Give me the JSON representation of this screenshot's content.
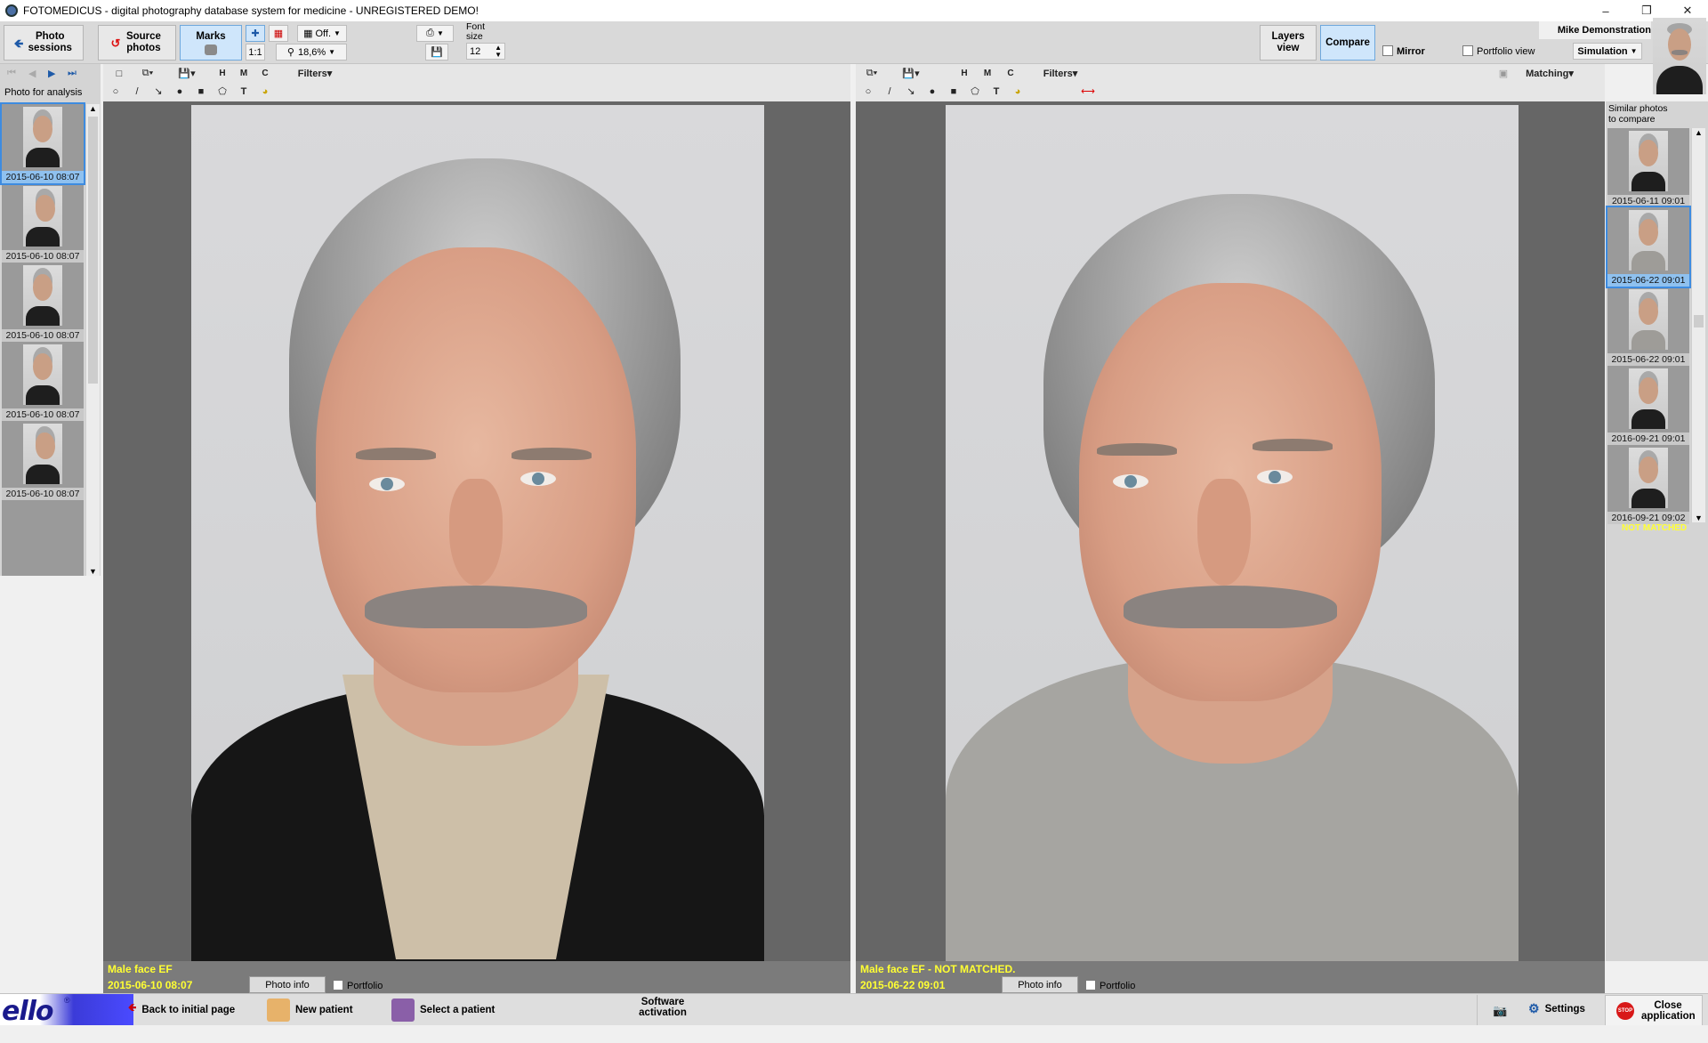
{
  "window": {
    "title": "FOTOMEDICUS - digital photography database system for medicine - UNREGISTERED DEMO!",
    "minimize": "–",
    "restore": "❐",
    "close": "✕"
  },
  "toolbar": {
    "photo_sessions": "Photo sessions",
    "source_photos": "Source photos",
    "marks": "Marks",
    "one_to_one": "1:1",
    "grid": "Off.",
    "zoom": "18,6%",
    "font_size_label": "Font size",
    "font_size_value": "12",
    "layers_view": "Layers view",
    "compare": "Compare",
    "mirror": "Mirror",
    "portfolio_view": "Portfolio view",
    "simulation": "Simulation",
    "user_name": "Mike Demonstration",
    "matching": "Matching"
  },
  "left": {
    "label": "Photo for analysis",
    "thumbnails": [
      {
        "date": "2015-06-10 08:07",
        "selected": true,
        "style": "dark"
      },
      {
        "date": "2015-06-10 08:07",
        "selected": false,
        "style": "profile"
      },
      {
        "date": "2015-06-10 08:07",
        "selected": false,
        "style": "dark"
      },
      {
        "date": "2015-06-10 08:07",
        "selected": false,
        "style": "dark"
      },
      {
        "date": "2015-06-10 08:07",
        "selected": false,
        "style": "profile"
      }
    ]
  },
  "editor_left": {
    "h": "H",
    "m": "M",
    "c": "C",
    "filters": "Filters",
    "text_tool": "T"
  },
  "editor_right": {
    "h": "H",
    "m": "M",
    "c": "C",
    "filters": "Filters",
    "text_tool": "T"
  },
  "photo_left": {
    "caption": "Male face EF",
    "date": "2015-06-10 08:07",
    "photo_info": "Photo info",
    "portfolio": "Portfolio"
  },
  "photo_right": {
    "caption": "Male face EF - NOT MATCHED.",
    "date": "2015-06-22 09:01",
    "photo_info": "Photo info",
    "portfolio": "Portfolio"
  },
  "right": {
    "label": "Similar photos to compare",
    "status": "NOT MATCHED",
    "thumbnails": [
      {
        "date": "2015-06-11 09:01",
        "selected": false,
        "style": "dark"
      },
      {
        "date": "2015-06-22 09:01",
        "selected": true,
        "style": "grey"
      },
      {
        "date": "2015-06-22 09:01",
        "selected": false,
        "style": "grey"
      },
      {
        "date": "2016-09-21 09:01",
        "selected": false,
        "style": "dark"
      },
      {
        "date": "2016-09-21 09:02",
        "selected": false,
        "style": "dark"
      }
    ]
  },
  "statusbar": {
    "logo": "ello",
    "logo_reg": "®",
    "back": "Back to initial page",
    "new_patient": "New patient",
    "select_patient": "Select a patient",
    "software_activation": "Software activation",
    "settings": "Settings",
    "close_application": "Close application",
    "stop_icon_text": "STOP"
  },
  "colors": {
    "caption_yellow": "#ffff33",
    "selected_blue": "#3d8be0"
  }
}
